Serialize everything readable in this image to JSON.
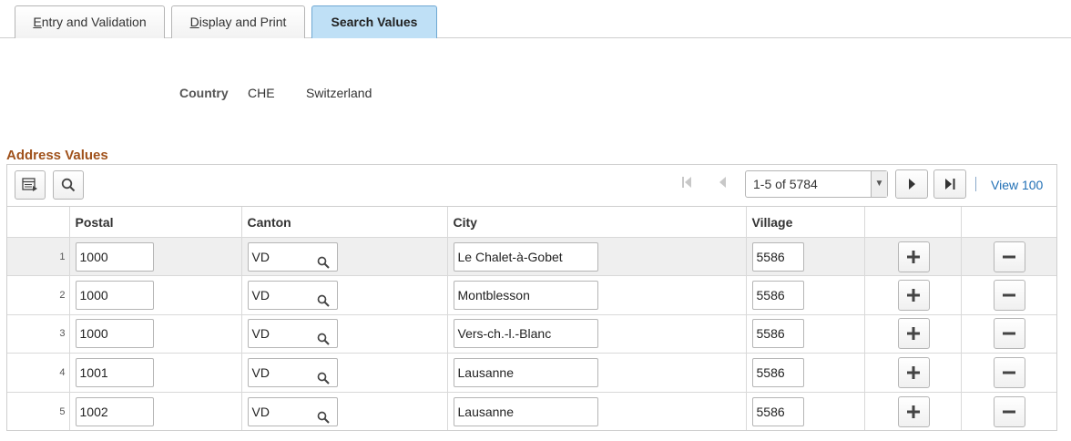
{
  "tabs": [
    {
      "label_pre": "",
      "accel": "E",
      "label_post": "ntry and Validation"
    },
    {
      "label_pre": "",
      "accel": "D",
      "label_post": "isplay and Print"
    },
    {
      "label": "Search Values"
    }
  ],
  "country": {
    "label": "Country",
    "code": "CHE",
    "name": "Switzerland"
  },
  "section_title": "Address Values",
  "toolbar": {
    "pager_text": "1-5 of 5784",
    "view_all": "View 100"
  },
  "columns": {
    "postal": "Postal",
    "canton": "Canton",
    "city": "City",
    "village": "Village"
  },
  "rows": [
    {
      "num": "1",
      "postal": "1000",
      "canton": "VD",
      "city": "Le Chalet-à-Gobet",
      "village": "5586"
    },
    {
      "num": "2",
      "postal": "1000",
      "canton": "VD",
      "city": "Montblesson",
      "village": "5586"
    },
    {
      "num": "3",
      "postal": "1000",
      "canton": "VD",
      "city": "Vers-ch.-l.-Blanc",
      "village": "5586"
    },
    {
      "num": "4",
      "postal": "1001",
      "canton": "VD",
      "city": "Lausanne",
      "village": "5586"
    },
    {
      "num": "5",
      "postal": "1002",
      "canton": "VD",
      "city": "Lausanne",
      "village": "5586"
    }
  ],
  "colors": {
    "accent_tab": "#bfe0f6",
    "section_title": "#a0521c",
    "link": "#1f6fb5"
  }
}
